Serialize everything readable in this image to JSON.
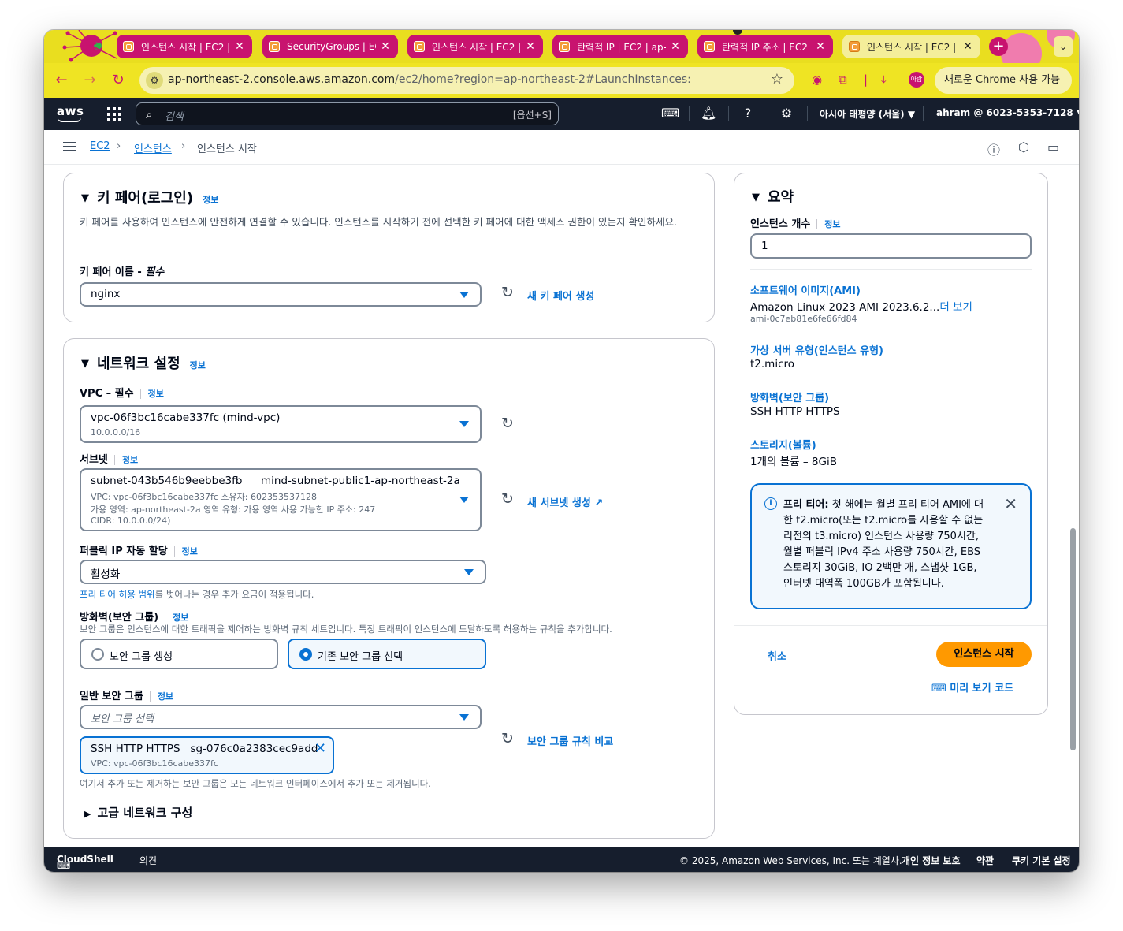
{
  "browser": {
    "tabs": [
      {
        "title": "인스턴스 시작 | EC2 | ap",
        "active": false
      },
      {
        "title": "SecurityGroups | EC2",
        "active": false
      },
      {
        "title": "인스턴스 시작 | EC2 | ap",
        "active": false
      },
      {
        "title": "탄력적 IP | EC2 | ap-no",
        "active": false
      },
      {
        "title": "탄력적 IP 주소 | EC2 |",
        "active": false
      },
      {
        "title": "인스턴스 시작 | EC2 | a",
        "active": true
      }
    ],
    "url_host": "ap-northeast-2.console.aws.amazon.com",
    "url_path": "/ec2/home?region=ap-northeast-2#LaunchInstances:",
    "profile_label": "아람",
    "chrome_update": "새로운 Chrome 사용 가능"
  },
  "aws_nav": {
    "logo": "aws",
    "search_placeholder": "검색",
    "search_shortcut": "[옵션+S]",
    "region": "아시아 태평양 (서울) ▼",
    "account": "ahram @ 6023-5353-7128 ▼"
  },
  "breadcrumb": {
    "root": "EC2",
    "parent": "인스턴스",
    "current": "인스턴스 시작"
  },
  "keypair": {
    "title": "키 페어(로그인)",
    "info": "정보",
    "description": "키 페어를 사용하여 인스턴스에 안전하게 연결할 수 있습니다. 인스턴스를 시작하기 전에 선택한 키 페어에 대한 액세스 권한이 있는지 확인하세요.",
    "label": "키 페어 이름 - ",
    "required": "필수",
    "value": "nginx",
    "create_link": "새 키 페어 생성"
  },
  "network": {
    "title": "네트워크 설정",
    "info": "정보",
    "vpc_label": "VPC – 필수",
    "vpc_value": "vpc-06f3bc16cabe337fc (mind-vpc)",
    "vpc_cidr": "10.0.0.0/16",
    "subnet_label": "서브넷",
    "subnet_id": "subnet-043b546b9eebbe3fb",
    "subnet_name": "mind-subnet-public1-ap-northeast-2a",
    "subnet_line1": "VPC: vpc-06f3bc16cabe337fc     소유자: 602353537128",
    "subnet_line2": "가용 영역: ap-northeast-2a     영역 유형: 가용 영역     사용 가능한 IP 주소: 247",
    "subnet_line3": "CIDR: 10.0.0.0/24)",
    "subnet_create": "새 서브넷 생성",
    "public_ip_label": "퍼블릭 IP 자동 할당",
    "public_ip_value": "활성화",
    "free_tier_link": "프리 티어 허용 범위",
    "free_tier_note": "를 벗어나는 경우 추가 요금이 적용됩니다.",
    "firewall_label": "방화벽(보안 그룹)",
    "firewall_desc": "보안 그룹은 인스턴스에 대한 트래픽을 제어하는 방화벽 규칙 세트입니다. 특정 트래픽이 인스턴스에 도달하도록 허용하는 규칙을 추가합니다.",
    "radio_create": "보안 그룹 생성",
    "radio_existing": "기존 보안 그룹 선택",
    "sg_label": "일반 보안 그룹",
    "sg_placeholder": "보안 그룹 선택",
    "sg_token_name": "SSH HTTP HTTPS",
    "sg_token_id": "sg-076c0a2383cec9add",
    "sg_token_vpc": "VPC: vpc-06f3bc16cabe337fc",
    "sg_compare": "보안 그룹 규칙 비교",
    "sg_note": "여기서 추가 또는 제거하는 보안 그룹은 모든 네트워크 인터페이스에서 추가 또는 제거됩니다.",
    "advanced": "고급 네트워크 구성"
  },
  "summary": {
    "title": "요약",
    "count_label": "인스턴스 개수",
    "info": "정보",
    "count_value": "1",
    "ami_label": "소프트웨어 이미지(AMI)",
    "ami_value": "Amazon Linux 2023 AMI 2023.6.2...",
    "ami_more": "더 보기",
    "ami_id": "ami-0c7eb81e6fe66fd84",
    "type_label": "가상 서버 유형(인스턴스 유형)",
    "type_value": "t2.micro",
    "fw_label": "방화벽(보안 그룹)",
    "fw_value": "SSH HTTP HTTPS",
    "storage_label": "스토리지(볼륨)",
    "storage_value": "1개의 볼륨 – 8GiB",
    "alert_bold": "프리 티어:",
    "alert_text": " 첫 해에는 월별 프리 티어 AMI에 대한 t2.micro(또는 t2.micro를 사용할 수 없는 리전의 t3.micro) 인스턴스 사용량 750시간, 월별 퍼블릭 IPv4 주소 사용량 750시간, EBS 스토리지 30GiB, IO 2백만 개, 스냅샷 1GB, 인터넷 대역폭 100GB가 포함됩니다.",
    "cancel": "취소",
    "launch": "인스턴스 시작",
    "preview": "미리 보기 코드"
  },
  "footer": {
    "cloudshell": "CloudShell",
    "feedback": "의견",
    "copyright": "© 2025, Amazon Web Services, Inc. 또는 계열사.",
    "privacy": "개인 정보 보호",
    "terms": "약관",
    "cookies": "쿠키 기본 설정"
  }
}
